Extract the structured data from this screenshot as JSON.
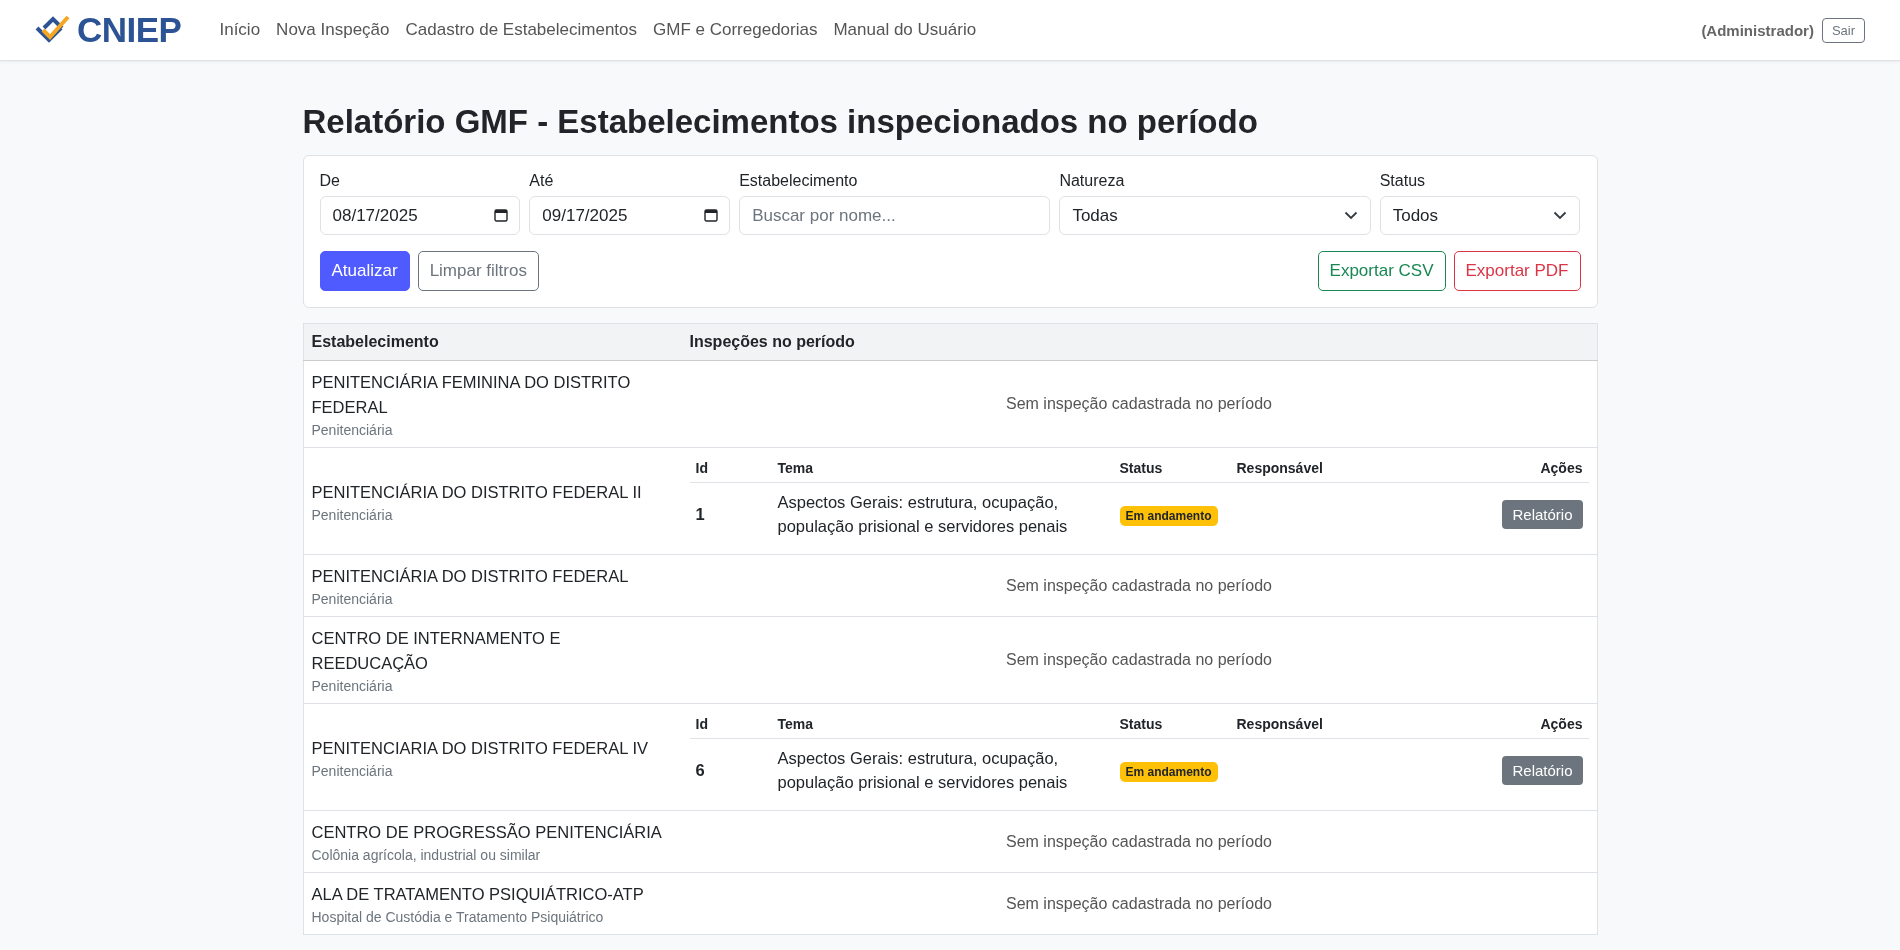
{
  "header": {
    "logo": "CNIEP",
    "nav": [
      "Início",
      "Nova Inspeção",
      "Cadastro de Estabelecimentos",
      "GMF e Corregedorias",
      "Manual do Usuário"
    ],
    "user": "(Administrador)",
    "logout": "Sair"
  },
  "page_title": "Relatório GMF - Estabelecimentos inspecionados no período",
  "filters": {
    "fields": [
      {
        "kind": "date",
        "label": "De",
        "value": "08/17/2025"
      },
      {
        "kind": "date",
        "label": "Até",
        "value": "09/17/2025"
      },
      {
        "kind": "text",
        "label": "Estabelecimento",
        "placeholder": "Buscar por nome..."
      },
      {
        "kind": "select",
        "label": "Natureza",
        "value": "Todas"
      },
      {
        "kind": "select",
        "label": "Status",
        "value": "Todos"
      }
    ],
    "buttons": [
      {
        "kind": "primary",
        "label": "Atualizar"
      },
      {
        "kind": "secondary",
        "label": "Limpar filtros"
      },
      {
        "kind": "success",
        "label": "Exportar CSV"
      },
      {
        "kind": "danger",
        "label": "Exportar PDF"
      }
    ]
  },
  "table": {
    "columns": [
      "Estabelecimento",
      "Inspeções no período"
    ],
    "rows": [
      {
        "name": "PENITENCIÁRIA FEMININA DO DISTRITO FEDERAL",
        "type": "Penitenciária",
        "empty_text": "Sem inspeção cadastrada no período"
      },
      {
        "name": "PENITENCIÁRIA DO DISTRITO FEDERAL II",
        "type": "Penitenciária",
        "inspection_columns": [
          "Id",
          "Tema",
          "Status",
          "Responsável",
          "Ações"
        ],
        "inspections": [
          {
            "id": "1",
            "theme": "Aspectos Gerais: estrutura, ocupação, população prisional e servidores penais",
            "status": "Em andamento",
            "action": "Relatório"
          }
        ]
      },
      {
        "name": "PENITENCIÁRIA DO DISTRITO FEDERAL",
        "type": "Penitenciária",
        "empty_text": "Sem inspeção cadastrada no período"
      },
      {
        "name": "CENTRO DE INTERNAMENTO E REEDUCAÇÃO",
        "type": "Penitenciária",
        "empty_text": "Sem inspeção cadastrada no período"
      },
      {
        "name": "PENITENCIARIA DO DISTRITO FEDERAL IV",
        "type": "Penitenciária",
        "inspection_columns": [
          "Id",
          "Tema",
          "Status",
          "Responsável",
          "Ações"
        ],
        "inspections": [
          {
            "id": "6",
            "theme": "Aspectos Gerais: estrutura, ocupação, população prisional e servidores penais",
            "status": "Em andamento",
            "action": "Relatório"
          }
        ]
      },
      {
        "name": "CENTRO DE PROGRESSÃO PENITENCIÁRIA",
        "type": "Colônia agrícola, industrial ou similar",
        "empty_text": "Sem inspeção cadastrada no período"
      },
      {
        "name": "ALA DE TRATAMENTO PSIQUIÁTRICO-ATP",
        "type": "Hospital de Custódia e Tratamento Psiquiátrico",
        "empty_text": "Sem inspeção cadastrada no período"
      }
    ]
  }
}
